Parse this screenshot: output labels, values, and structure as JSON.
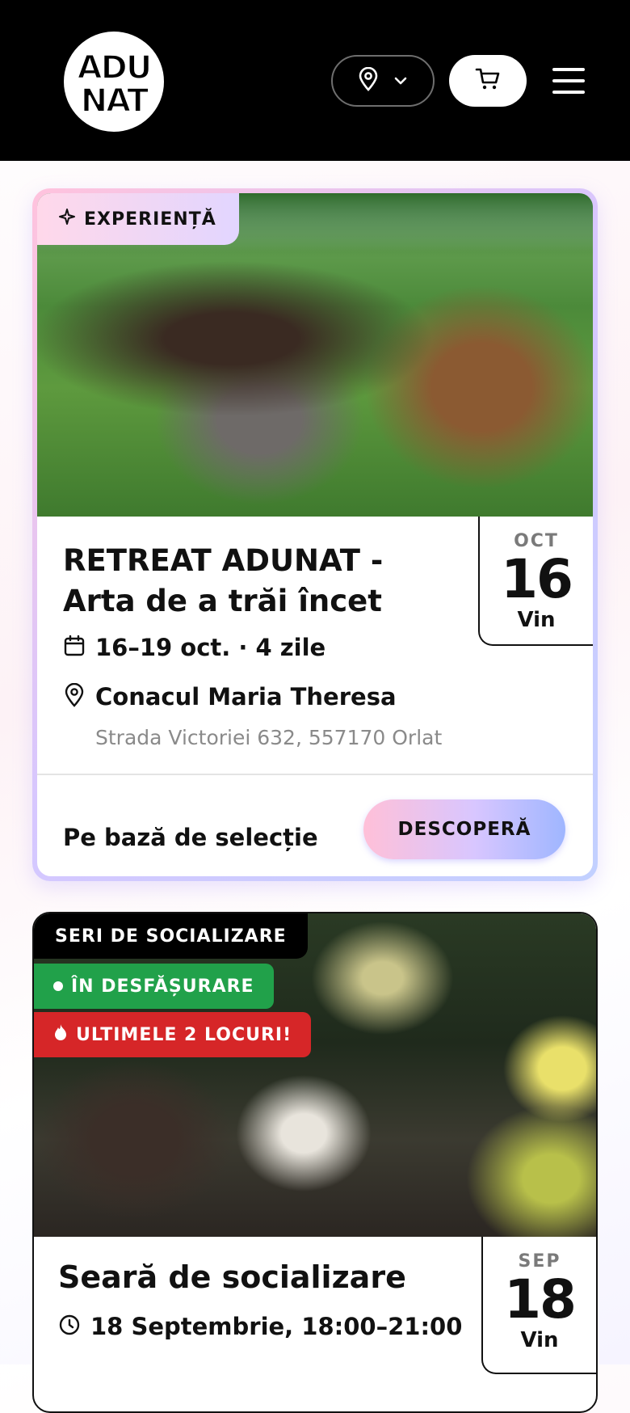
{
  "header": {
    "logo_text": "ADUNAT",
    "location_icon": "map-pin-icon",
    "location_chevron": "chevron-down-icon",
    "cart_icon": "cart-icon",
    "menu_icon": "hamburger-menu-icon"
  },
  "events": [
    {
      "tag": "EXPERIENȚĂ",
      "tag_icon": "sparkle-icon",
      "title": "RETREAT ADUNAT - Arta de a trăi încet",
      "date_range": "16–19 oct. · 4 zile",
      "venue": "Conacul Maria Theresa",
      "address": "Strada Victoriei 632, 557170 Orlat",
      "date_month": "OCT",
      "date_day": "16",
      "date_weekday": "Vin",
      "footer_text": "Pe bază de selecție",
      "cta_label": "DESCOPERĂ"
    },
    {
      "tag": "SERI DE SOCIALIZARE",
      "status_badge": "ÎN DESFĂȘURARE",
      "urgency_badge": "ULTIMELE 2 LOCURI!",
      "title": "Seară de socializare",
      "time": "18 Septembrie, 18:00–21:00",
      "date_month": "SEP",
      "date_day": "18",
      "date_weekday": "Vin"
    }
  ],
  "colors": {
    "header_bg": "#000000",
    "live_badge": "#21a14a",
    "urgent_badge": "#d62628",
    "card_gradient_start": "#ffc3dd",
    "card_gradient_end": "#c2d0ff"
  }
}
